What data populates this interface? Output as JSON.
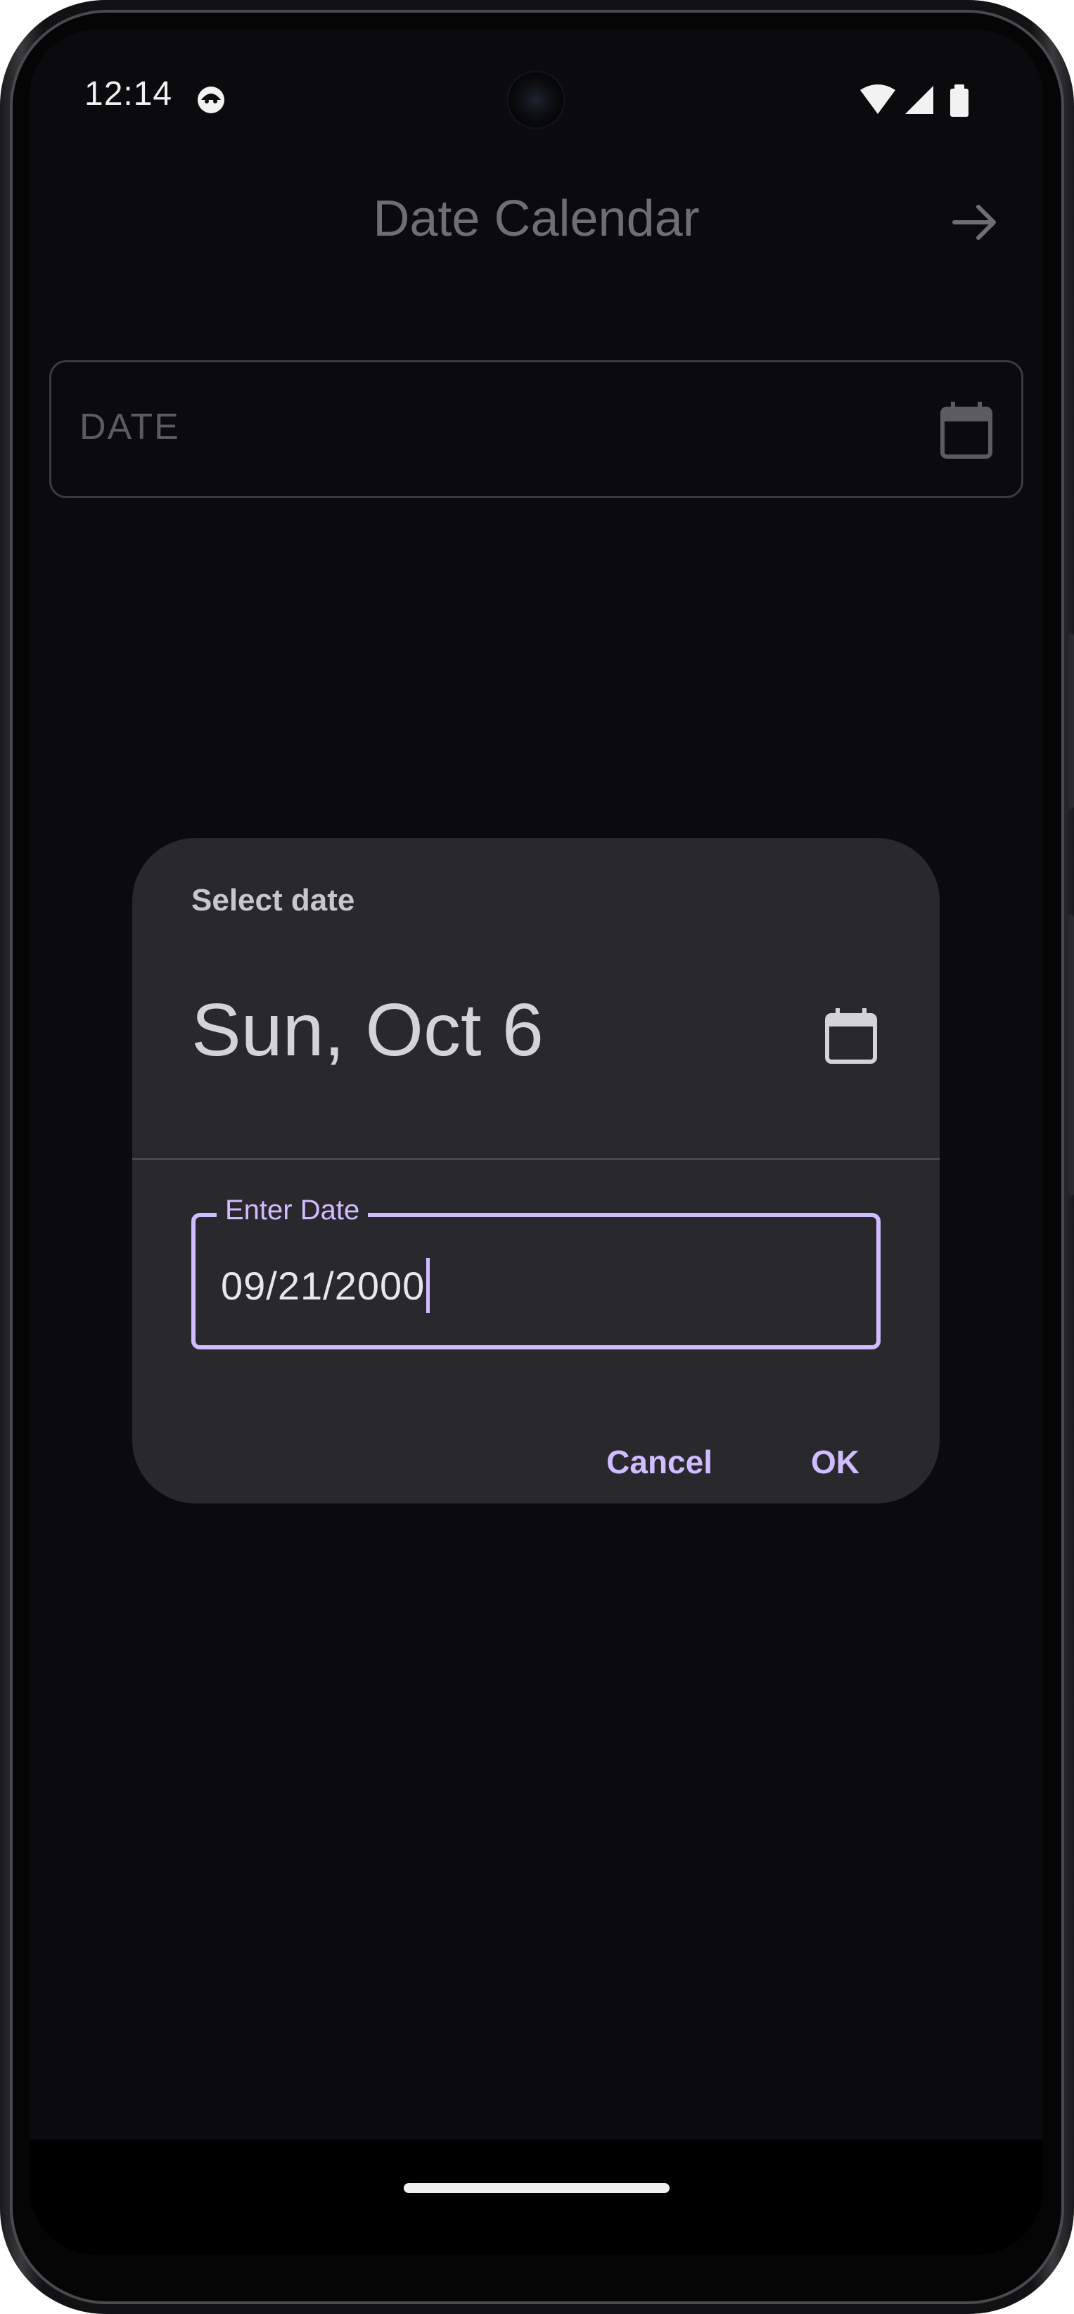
{
  "status_bar": {
    "time": "12:14",
    "icons": [
      "app-notification-icon",
      "wifi-icon",
      "cellular-signal-icon",
      "battery-icon"
    ]
  },
  "app_bar": {
    "title": "Date Calendar",
    "action_icon": "arrow-forward-icon"
  },
  "date_field": {
    "placeholder": "DATE",
    "trailing_icon": "calendar-icon"
  },
  "dialog": {
    "title": "Select date",
    "headline": "Sun, Oct 6",
    "mode_toggle_icon": "calendar-icon",
    "input": {
      "label": "Enter Date",
      "value": "09/21/2000"
    },
    "actions": {
      "cancel_label": "Cancel",
      "ok_label": "OK"
    }
  },
  "colors": {
    "accent": "#d0bcff",
    "dialog_surface": "#29282d",
    "background": "#0b0b0d"
  }
}
